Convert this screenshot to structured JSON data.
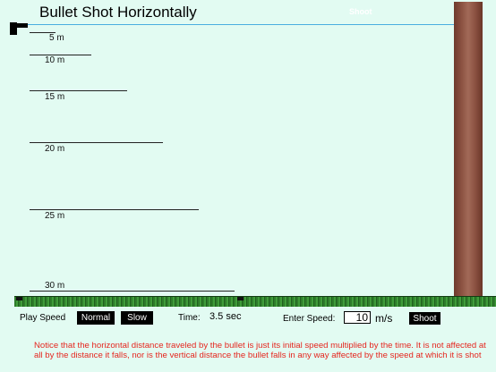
{
  "title": "Bullet Shot Horizontally",
  "hint_text": "Shoot",
  "height_markers": [
    {
      "label": "5 m"
    },
    {
      "label": "10 m"
    },
    {
      "label": "15 m"
    },
    {
      "label": "20 m"
    },
    {
      "label": "25 m"
    },
    {
      "label": "30 m"
    }
  ],
  "controls": {
    "play_speed_label": "Play Speed",
    "normal_label": "Normal",
    "slow_label": "Slow",
    "time_label": "Time:",
    "time_value": "3.5 sec",
    "enter_speed_label": "Enter Speed:",
    "speed_value": "10",
    "speed_unit": "m/s",
    "shoot_label": "Shoot"
  },
  "notice": "Notice that the horizontal distance traveled by the bullet is just its initial speed multiplied by the time.  It is not affected at all by the distance it falls, nor is the vertical distance the bullet falls in any way affected by the speed at which it is shot",
  "colors": {
    "background": "#e2fbf2",
    "notice_text": "#e5261f",
    "aim_line": "#4aaee0",
    "ground": "#3f9c3a",
    "tree": "#8a5040"
  }
}
